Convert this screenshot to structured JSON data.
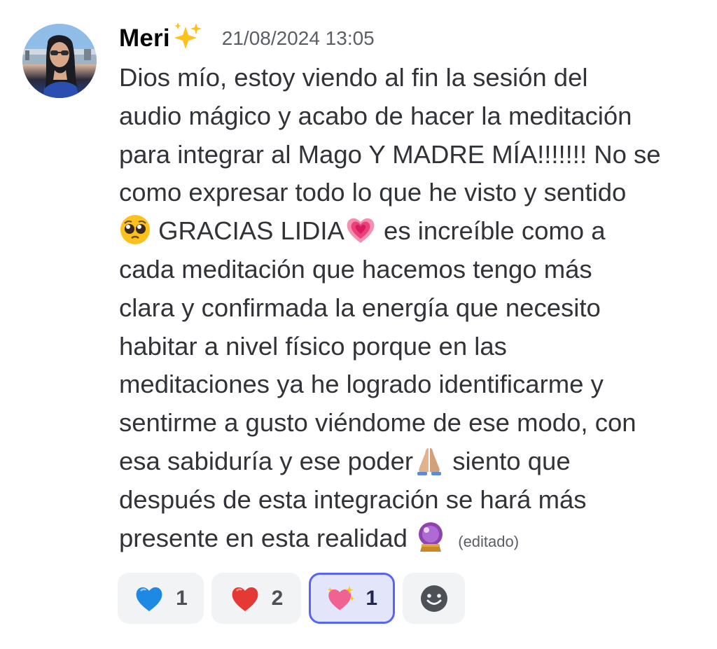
{
  "message": {
    "author": "Meri",
    "author_decoration_icon": "sparkles-emoji",
    "timestamp": "21/08/2024 13:05",
    "lines": [
      "Dios mío, estoy viendo al fin la sesión del",
      "audio mágico y acabo de hacer la meditación",
      "para integrar al Mago Y MADRE MÍA!!!!!!! No se",
      "como expresar todo lo que he visto y sentido",
      "GRACIAS LIDIA",
      "es increíble como a",
      "cada meditación que hacemos tengo más",
      "clara y confirmada la energía que necesito",
      "habitar a nivel físico porque en las",
      "meditaciones ya he logrado identificarme y",
      "sentirme a gusto viéndome de ese modo, con",
      "esa sabiduría y ese poder",
      "siento que",
      "después de esta integración se hará más",
      "presente en esta realidad"
    ],
    "inline_emojis": [
      "pleading-face-emoji",
      "growing-heart-emoji",
      "folded-hands-emoji",
      "crystal-ball-emoji"
    ],
    "edited_label": "(editado)"
  },
  "reactions": [
    {
      "emoji": "blue-heart-emoji",
      "count": "1",
      "selected": false
    },
    {
      "emoji": "red-heart-emoji",
      "count": "2",
      "selected": false
    },
    {
      "emoji": "sparkling-heart-emoji",
      "count": "1",
      "selected": true
    }
  ],
  "add_reaction_icon": "add-reaction-smiley-icon",
  "colors": {
    "text": "#313338",
    "muted": "#5c5e66",
    "accent": "#5865f2",
    "reaction_bg": "#f2f3f5",
    "reaction_selected_bg": "#e3e5fb"
  }
}
